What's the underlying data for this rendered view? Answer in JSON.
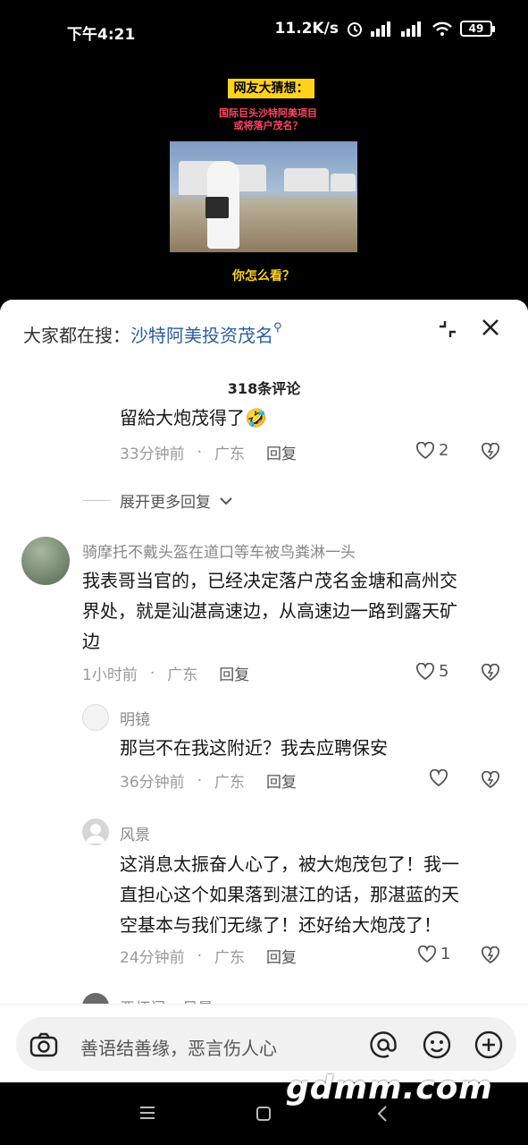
{
  "status_bar": {
    "time": "下午4:21",
    "net_speed": "11.2K/s",
    "battery": "49"
  },
  "video": {
    "tag": "网友大猜想：",
    "subtitle_line1": "国际巨头沙特阿美项目",
    "subtitle_line2": "或将落户茂名？",
    "question": "你怎么看？"
  },
  "comments_sheet": {
    "search_prefix": "大家都在搜：",
    "search_keyword": "沙特阿美投资茂名",
    "comment_count": "318条评论",
    "items": [
      {
        "text": "留給大炮茂得了🤣",
        "time": "33分钟前",
        "location": "广东",
        "reply": "回复",
        "likes": "2"
      },
      {
        "expand_label": "展开更多回复"
      },
      {
        "name": "骑摩托不戴头盔在道口等车被鸟粪淋一头",
        "text_line1": "我表哥当官的，已经决定落户茂名金塘和高州交",
        "text_line2": "界处，就是汕湛高速边，从高速边一路到露天矿",
        "text_line3": "边",
        "time": "1小时前",
        "location": "广东",
        "reply": "回复",
        "likes": "5"
      },
      {
        "name": "明镜",
        "text": "那岂不在我这附近？我去应聘保安",
        "time": "36分钟前",
        "location": "广东",
        "reply": "回复",
        "likes": ""
      },
      {
        "name": "风景",
        "text_line1": "这消息太振奋人心了，被大炮茂包了！我一",
        "text_line2": "直担心这个如果落到湛江的话，那湛蓝的天",
        "text_line3": "空基本与我们无缘了！还好给大炮茂了！",
        "time": "24分钟前",
        "location": "广东",
        "reply": "回复",
        "likes": "1"
      }
    ],
    "partial_name": "恶虾门 ▸ 风景"
  },
  "input_bar": {
    "placeholder": "善语结善缘，恶言伤人心"
  },
  "watermark": "gdmm.com",
  "colors": {
    "keyword": "#2a5ea0",
    "video_tag_bg": "#ffd21e",
    "video_subtitle": "#ff4560"
  }
}
